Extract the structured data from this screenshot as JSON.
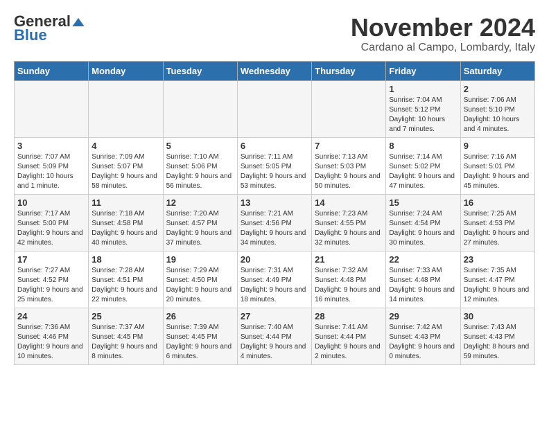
{
  "header": {
    "logo_general": "General",
    "logo_blue": "Blue",
    "month_title": "November 2024",
    "location": "Cardano al Campo, Lombardy, Italy"
  },
  "days_of_week": [
    "Sunday",
    "Monday",
    "Tuesday",
    "Wednesday",
    "Thursday",
    "Friday",
    "Saturday"
  ],
  "weeks": [
    [
      {
        "day": "",
        "info": ""
      },
      {
        "day": "",
        "info": ""
      },
      {
        "day": "",
        "info": ""
      },
      {
        "day": "",
        "info": ""
      },
      {
        "day": "",
        "info": ""
      },
      {
        "day": "1",
        "info": "Sunrise: 7:04 AM\nSunset: 5:12 PM\nDaylight: 10 hours and 7 minutes."
      },
      {
        "day": "2",
        "info": "Sunrise: 7:06 AM\nSunset: 5:10 PM\nDaylight: 10 hours and 4 minutes."
      }
    ],
    [
      {
        "day": "3",
        "info": "Sunrise: 7:07 AM\nSunset: 5:09 PM\nDaylight: 10 hours and 1 minute."
      },
      {
        "day": "4",
        "info": "Sunrise: 7:09 AM\nSunset: 5:07 PM\nDaylight: 9 hours and 58 minutes."
      },
      {
        "day": "5",
        "info": "Sunrise: 7:10 AM\nSunset: 5:06 PM\nDaylight: 9 hours and 56 minutes."
      },
      {
        "day": "6",
        "info": "Sunrise: 7:11 AM\nSunset: 5:05 PM\nDaylight: 9 hours and 53 minutes."
      },
      {
        "day": "7",
        "info": "Sunrise: 7:13 AM\nSunset: 5:03 PM\nDaylight: 9 hours and 50 minutes."
      },
      {
        "day": "8",
        "info": "Sunrise: 7:14 AM\nSunset: 5:02 PM\nDaylight: 9 hours and 47 minutes."
      },
      {
        "day": "9",
        "info": "Sunrise: 7:16 AM\nSunset: 5:01 PM\nDaylight: 9 hours and 45 minutes."
      }
    ],
    [
      {
        "day": "10",
        "info": "Sunrise: 7:17 AM\nSunset: 5:00 PM\nDaylight: 9 hours and 42 minutes."
      },
      {
        "day": "11",
        "info": "Sunrise: 7:18 AM\nSunset: 4:58 PM\nDaylight: 9 hours and 40 minutes."
      },
      {
        "day": "12",
        "info": "Sunrise: 7:20 AM\nSunset: 4:57 PM\nDaylight: 9 hours and 37 minutes."
      },
      {
        "day": "13",
        "info": "Sunrise: 7:21 AM\nSunset: 4:56 PM\nDaylight: 9 hours and 34 minutes."
      },
      {
        "day": "14",
        "info": "Sunrise: 7:23 AM\nSunset: 4:55 PM\nDaylight: 9 hours and 32 minutes."
      },
      {
        "day": "15",
        "info": "Sunrise: 7:24 AM\nSunset: 4:54 PM\nDaylight: 9 hours and 30 minutes."
      },
      {
        "day": "16",
        "info": "Sunrise: 7:25 AM\nSunset: 4:53 PM\nDaylight: 9 hours and 27 minutes."
      }
    ],
    [
      {
        "day": "17",
        "info": "Sunrise: 7:27 AM\nSunset: 4:52 PM\nDaylight: 9 hours and 25 minutes."
      },
      {
        "day": "18",
        "info": "Sunrise: 7:28 AM\nSunset: 4:51 PM\nDaylight: 9 hours and 22 minutes."
      },
      {
        "day": "19",
        "info": "Sunrise: 7:29 AM\nSunset: 4:50 PM\nDaylight: 9 hours and 20 minutes."
      },
      {
        "day": "20",
        "info": "Sunrise: 7:31 AM\nSunset: 4:49 PM\nDaylight: 9 hours and 18 minutes."
      },
      {
        "day": "21",
        "info": "Sunrise: 7:32 AM\nSunset: 4:48 PM\nDaylight: 9 hours and 16 minutes."
      },
      {
        "day": "22",
        "info": "Sunrise: 7:33 AM\nSunset: 4:48 PM\nDaylight: 9 hours and 14 minutes."
      },
      {
        "day": "23",
        "info": "Sunrise: 7:35 AM\nSunset: 4:47 PM\nDaylight: 9 hours and 12 minutes."
      }
    ],
    [
      {
        "day": "24",
        "info": "Sunrise: 7:36 AM\nSunset: 4:46 PM\nDaylight: 9 hours and 10 minutes."
      },
      {
        "day": "25",
        "info": "Sunrise: 7:37 AM\nSunset: 4:45 PM\nDaylight: 9 hours and 8 minutes."
      },
      {
        "day": "26",
        "info": "Sunrise: 7:39 AM\nSunset: 4:45 PM\nDaylight: 9 hours and 6 minutes."
      },
      {
        "day": "27",
        "info": "Sunrise: 7:40 AM\nSunset: 4:44 PM\nDaylight: 9 hours and 4 minutes."
      },
      {
        "day": "28",
        "info": "Sunrise: 7:41 AM\nSunset: 4:44 PM\nDaylight: 9 hours and 2 minutes."
      },
      {
        "day": "29",
        "info": "Sunrise: 7:42 AM\nSunset: 4:43 PM\nDaylight: 9 hours and 0 minutes."
      },
      {
        "day": "30",
        "info": "Sunrise: 7:43 AM\nSunset: 4:43 PM\nDaylight: 8 hours and 59 minutes."
      }
    ]
  ]
}
